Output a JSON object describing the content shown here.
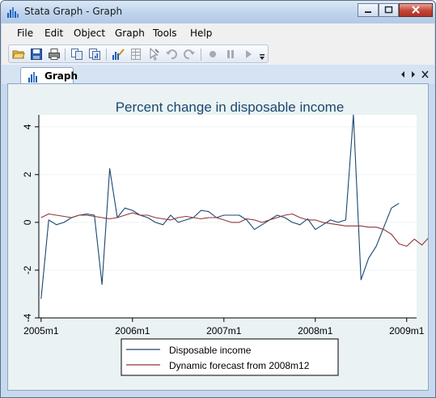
{
  "window": {
    "title": "Stata Graph - Graph"
  },
  "menu": [
    "File",
    "Edit",
    "Object",
    "Graph",
    "Tools",
    "Help"
  ],
  "toolbar": {
    "icons": [
      "open-icon",
      "save-icon",
      "print-icon",
      "copy-icon",
      "copy-graph-icon",
      "graph-editor-icon",
      "grid-edit-icon",
      "pointer-icon",
      "undo-icon",
      "redo-icon",
      "record-icon",
      "pause-icon",
      "play-icon"
    ]
  },
  "tab": {
    "label": "Graph"
  },
  "colors": {
    "title": "#1a476f",
    "series1": "#1a476f",
    "series2": "#90353b",
    "plot_bg": "#ffffff",
    "graph_bg": "#eaf2f3"
  },
  "chart_data": {
    "type": "line",
    "title": "Percent change in disposable income",
    "xlabel": "",
    "ylabel": "",
    "x_ticks": [
      "2005m1",
      "2006m1",
      "2007m1",
      "2008m1",
      "2009m1"
    ],
    "y_ticks": [
      "-4",
      "-2",
      "0",
      "2",
      "4"
    ],
    "ylim": [
      -4,
      4.5
    ],
    "xlim": [
      "2005m1",
      "2009m2"
    ],
    "grid": true,
    "legend_position": "bottom",
    "series": [
      {
        "name": "Disposable income",
        "color": "#1a476f",
        "x_start": "2005m1",
        "values": [
          -3.2,
          0.1,
          -0.1,
          0.0,
          0.2,
          0.3,
          0.35,
          0.3,
          -2.6,
          2.25,
          0.2,
          0.6,
          0.5,
          0.3,
          0.2,
          0.0,
          -0.1,
          0.3,
          0.0,
          0.1,
          0.2,
          0.5,
          0.45,
          0.2,
          0.3,
          0.3,
          0.3,
          0.1,
          -0.3,
          -0.1,
          0.1,
          0.3,
          0.2,
          0.0,
          -0.1,
          0.15,
          -0.3,
          -0.1,
          0.1,
          0.0,
          0.1,
          4.5,
          -2.4,
          -1.5,
          -1.0,
          -0.2,
          0.6,
          0.8
        ]
      },
      {
        "name": "Dynamic forecast from 2008m12",
        "color": "#90353b",
        "x_start": "2005m1",
        "values": [
          0.2,
          0.35,
          0.3,
          0.25,
          0.2,
          0.3,
          0.3,
          0.25,
          0.2,
          0.15,
          0.2,
          0.3,
          0.4,
          0.3,
          0.3,
          0.2,
          0.15,
          0.1,
          0.2,
          0.25,
          0.2,
          0.15,
          0.2,
          0.2,
          0.1,
          0.0,
          0.0,
          0.15,
          0.1,
          0.0,
          0.1,
          0.2,
          0.3,
          0.35,
          0.2,
          0.1,
          0.1,
          0.0,
          -0.05,
          -0.1,
          -0.15,
          -0.15,
          -0.15,
          -0.2,
          -0.2,
          -0.3,
          -0.5,
          -0.9,
          -1.0,
          -0.7,
          -0.95,
          -0.6
        ]
      }
    ]
  }
}
